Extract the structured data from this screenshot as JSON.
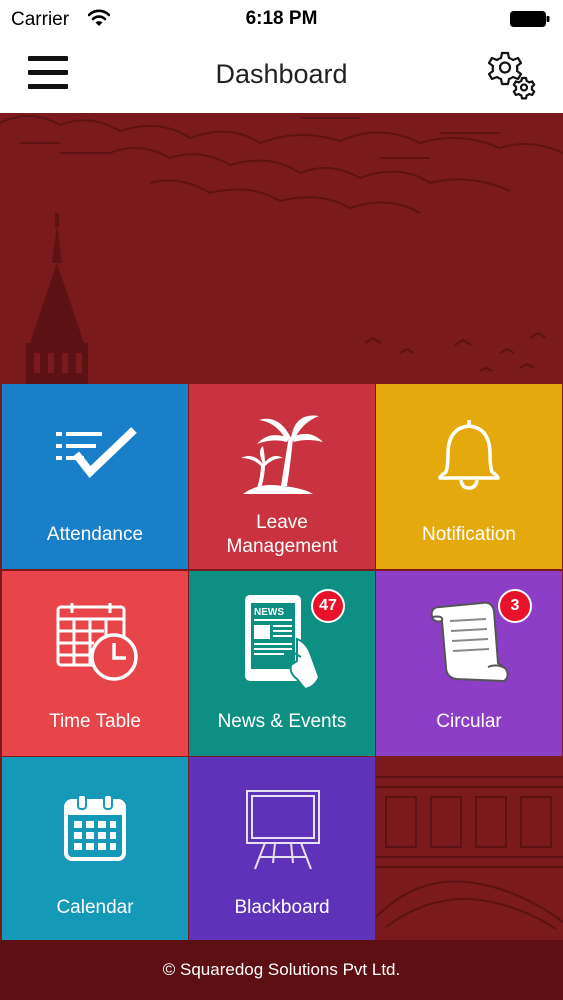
{
  "status_bar": {
    "carrier": "Carrier",
    "time": "6:18 PM"
  },
  "nav": {
    "title": "Dashboard",
    "menu_icon": "hamburger-menu-icon",
    "settings_icon": "gear-icon"
  },
  "tiles": [
    {
      "label": "Attendance",
      "icon": "checklist-icon",
      "color": "#1a7fc9"
    },
    {
      "label_line1": "Leave",
      "label_line2": "Management",
      "icon": "palm-island-icon",
      "color": "#c8333f"
    },
    {
      "label": "Notification",
      "icon": "bell-icon",
      "color": "#e4a90c"
    },
    {
      "label": "Time Table",
      "icon": "calendar-clock-icon",
      "color": "#e7454a"
    },
    {
      "label": "News & Events",
      "icon": "news-tablet-icon",
      "color": "#0e8f84",
      "badge": "47"
    },
    {
      "label": "Circular",
      "icon": "scroll-icon",
      "color": "#8c3ec6",
      "badge": "3"
    },
    {
      "label": "Calendar",
      "icon": "calendar-icon",
      "color": "#1599b8"
    },
    {
      "label": "Blackboard",
      "icon": "blackboard-icon",
      "color": "#5e33ba"
    }
  ],
  "colors": {
    "background": "#7a1a1c",
    "footer": "#5d0f12",
    "badge": "#e8132b"
  },
  "footer": {
    "copyright": "© Squaredog Solutions Pvt Ltd."
  }
}
